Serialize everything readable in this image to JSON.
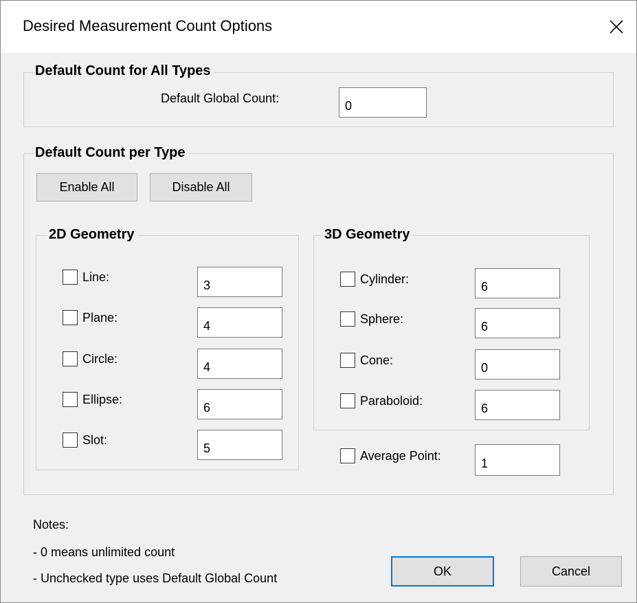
{
  "window": {
    "title": "Desired Measurement Count Options"
  },
  "global_group": {
    "title": "Default Count for All Types",
    "label": "Default Global Count:",
    "value": "0"
  },
  "per_type_group": {
    "title": "Default Count per Type",
    "enable_all": "Enable All",
    "disable_all": "Disable All"
  },
  "geom2d": {
    "title": "2D Geometry",
    "items": [
      {
        "label": "Line:",
        "value": "3",
        "checked": false
      },
      {
        "label": "Plane:",
        "value": "4",
        "checked": false
      },
      {
        "label": "Circle:",
        "value": "4",
        "checked": false
      },
      {
        "label": "Ellipse:",
        "value": "6",
        "checked": false
      },
      {
        "label": "Slot:",
        "value": "5",
        "checked": false
      }
    ]
  },
  "geom3d": {
    "title": "3D Geometry",
    "items": [
      {
        "label": "Cylinder:",
        "value": "6",
        "checked": false
      },
      {
        "label": "Sphere:",
        "value": "6",
        "checked": false
      },
      {
        "label": "Cone:",
        "value": "0",
        "checked": false
      },
      {
        "label": "Paraboloid:",
        "value": "6",
        "checked": false
      }
    ]
  },
  "average_point": {
    "label": "Average Point:",
    "value": "1",
    "checked": false
  },
  "notes": {
    "heading": "Notes:",
    "line1": "- 0 means unlimited count",
    "line2": "- Unchecked type uses Default Global Count"
  },
  "buttons": {
    "ok": "OK",
    "cancel": "Cancel"
  },
  "colors": {
    "accent": "#0078d7",
    "background": "#f0f0f0",
    "titlebar": "#ffffff"
  }
}
